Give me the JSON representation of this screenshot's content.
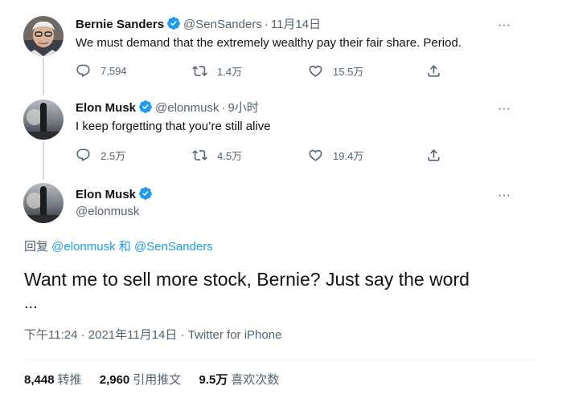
{
  "tweets": [
    {
      "name": "Bernie Sanders",
      "handle": "@SenSanders",
      "time": "11月14日",
      "text": "We must demand that the extremely wealthy pay their fair share. Period.",
      "replies": "7,594",
      "retweets": "1.4万",
      "likes": "15.5万"
    },
    {
      "name": "Elon Musk",
      "handle": "@elonmusk",
      "time": "9小时",
      "text": "I keep forgetting that you’re still alive",
      "replies": "2.5万",
      "retweets": "4.5万",
      "likes": "19.4万"
    }
  ],
  "main": {
    "name": "Elon Musk",
    "handle": "@elonmusk",
    "reply_prefix": "回复 ",
    "reply_to_1": "@elonmusk",
    "reply_join": " 和 ",
    "reply_to_2": "@SenSanders",
    "text": "Want me to sell more stock, Bernie? Just say the word",
    "ellipsis": "...",
    "timestamp": "下午11:24 · 2021年11月14日 · Twitter for iPhone",
    "stats": [
      {
        "value": "8,448",
        "label": "转推"
      },
      {
        "value": "2,960",
        "label": "引用推文"
      },
      {
        "value": "9.5万",
        "label": "喜欢次数"
      }
    ]
  },
  "more_glyph": "···",
  "dot": "·",
  "colors": {
    "accent": "#1d9bf0",
    "muted": "#536471",
    "text": "#0f1419",
    "thread": "#cfd9de"
  }
}
